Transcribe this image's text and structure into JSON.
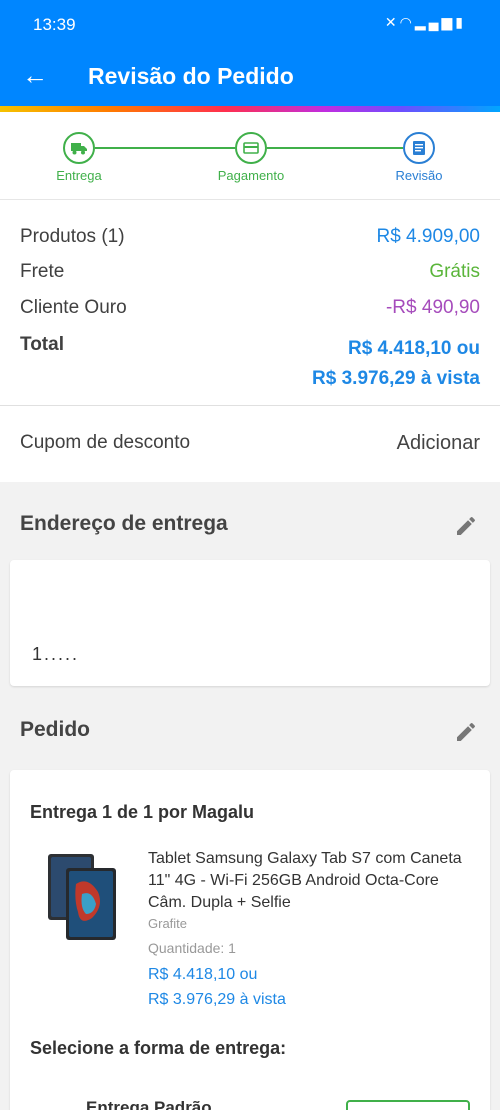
{
  "status_bar": {
    "time": "13:39",
    "icons": [
      "mute-icon",
      "wifi-icon",
      "signal-icon",
      "signal-icon",
      "battery-icon"
    ]
  },
  "header": {
    "title": "Revisão do Pedido"
  },
  "steps": [
    {
      "label": "Entrega",
      "state": "done",
      "icon": "truck-icon"
    },
    {
      "label": "Pagamento",
      "state": "done",
      "icon": "card-icon"
    },
    {
      "label": "Revisão",
      "state": "current",
      "icon": "document-icon"
    }
  ],
  "summary": {
    "products_label": "Produtos (1)",
    "products_value": "R$ 4.909,00",
    "shipping_label": "Frete",
    "shipping_value": "Grátis",
    "gold_label": "Cliente Ouro",
    "gold_value": "-R$ 490,90",
    "total_label": "Total",
    "total_value_1": "R$ 4.418,10 ou",
    "total_value_2": "R$ 3.976,29 à vista"
  },
  "coupon": {
    "label": "Cupom de desconto",
    "action": "Adicionar"
  },
  "address": {
    "title": "Endereço de entrega",
    "zip_partial": "1....."
  },
  "order": {
    "title": "Pedido",
    "delivery_title": "Entrega 1 de 1 por Magalu",
    "product_name": "Tablet Samsung Galaxy Tab S7 com Caneta 11\" 4G - Wi-Fi 256GB Android Octa-Core Câm. Dupla + Selfie",
    "product_color": "Grafite",
    "quantity_label": "Quantidade: 1",
    "price_1": "R$ 4.418,10 ou",
    "price_2": "R$ 3.976,29 à vista",
    "shipping_select_title": "Selecione a forma de entrega:",
    "shipping_option": "Entrega Padrão"
  },
  "colors": {
    "primary": "#0086ff",
    "success": "#40b04a",
    "link": "#1e88e5",
    "discount": "#a64cbc"
  }
}
